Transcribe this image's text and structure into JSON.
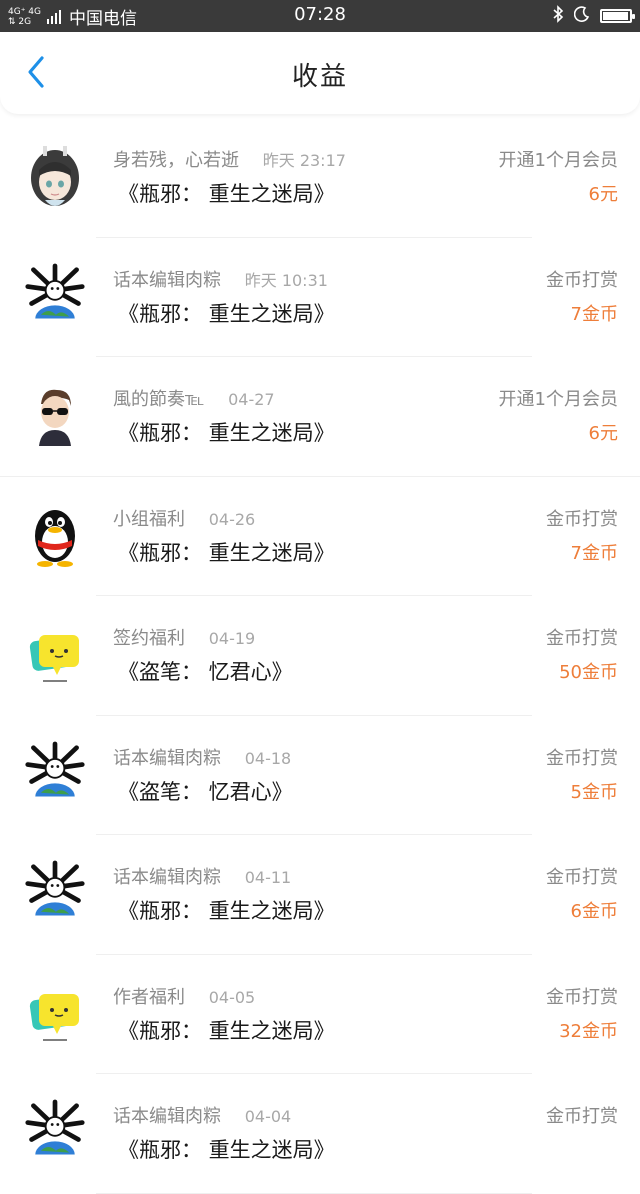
{
  "status_bar": {
    "network_top": "4G⁺ 4G",
    "network_bottom": "⇅ 2G",
    "carrier": "中国电信",
    "time": "07:28",
    "battery_level": 0.95
  },
  "header": {
    "title": "收益",
    "back_icon": "chevron-left-icon",
    "accent_color": "#1e90e8"
  },
  "colors": {
    "amount": "#ee7e3a",
    "secondary_text": "#8a8a8a",
    "primary_text": "#1a1a1a"
  },
  "items": [
    {
      "name": "身若残，心若逝",
      "time": "昨天 23:17",
      "book": "《瓶邪： 重生之迷局》",
      "type": "开通1个月会员",
      "amount": "6元",
      "avatar": "anime-girl-avatar"
    },
    {
      "name": "话本编辑肉粽",
      "time": "昨天 10:31",
      "book": "《瓶邪： 重生之迷局》",
      "type": "金币打赏",
      "amount": "7金币",
      "avatar": "cartoon-globe-avatar"
    },
    {
      "name": "風的節奏℡",
      "time": "04-27",
      "book": "《瓶邪： 重生之迷局》",
      "type": "开通1个月会员",
      "amount": "6元",
      "avatar": "sunglasses-man-avatar"
    },
    {
      "name": "小组福利",
      "time": "04-26",
      "book": "《瓶邪： 重生之迷局》",
      "type": "金币打赏",
      "amount": "7金币",
      "avatar": "penguin-avatar"
    },
    {
      "name": "签约福利",
      "time": "04-19",
      "book": "《盗笔： 忆君心》",
      "type": "金币打赏",
      "amount": "50金币",
      "avatar": "chat-bubble-avatar"
    },
    {
      "name": "话本编辑肉粽",
      "time": "04-18",
      "book": "《盗笔： 忆君心》",
      "type": "金币打赏",
      "amount": "5金币",
      "avatar": "cartoon-globe-avatar"
    },
    {
      "name": "话本编辑肉粽",
      "time": "04-11",
      "book": "《瓶邪： 重生之迷局》",
      "type": "金币打赏",
      "amount": "6金币",
      "avatar": "cartoon-globe-avatar"
    },
    {
      "name": "作者福利",
      "time": "04-05",
      "book": "《瓶邪： 重生之迷局》",
      "type": "金币打赏",
      "amount": "32金币",
      "avatar": "chat-bubble-avatar"
    },
    {
      "name": "话本编辑肉粽",
      "time": "04-04",
      "book": "《瓶邪： 重生之迷局》",
      "type": "金币打赏",
      "amount": "",
      "avatar": "cartoon-globe-avatar"
    }
  ]
}
